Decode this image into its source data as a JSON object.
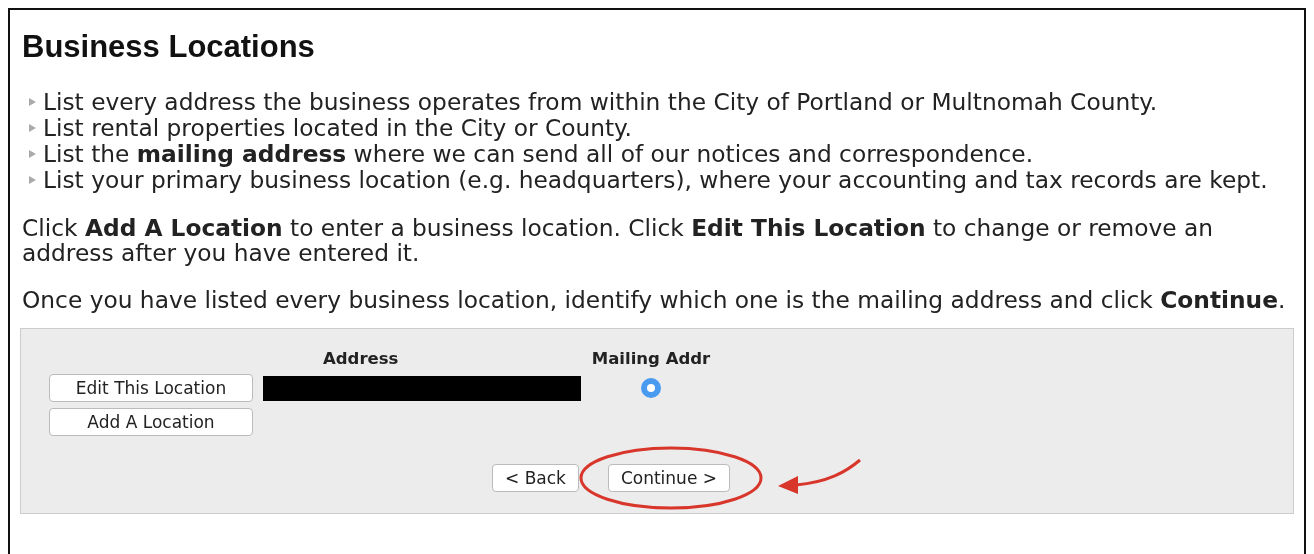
{
  "heading": "Business Locations",
  "bullets": [
    "List every address the business operates from within the City of Portland or Multnomah County.",
    "List rental properties located in the City or County.",
    "List the **mailing address** where we can send all of our notices and correspondence.",
    "List your primary business location (e.g. headquarters), where your accounting and tax records are kept."
  ],
  "paragraphs": [
    "Click **Add A Location** to enter a business location. Click **Edit This Location** to change or remove an address after you have entered it.",
    "Once you have listed every business location, identify which one is the mailing address and click **Continue**."
  ],
  "locations": {
    "columns": [
      "Address",
      "Mailing Addr"
    ],
    "rows": [
      {
        "edit_button": "Edit This Location",
        "address_redacted": true,
        "selected": true
      }
    ],
    "add_button": "Add A Location"
  },
  "nav_buttons": [
    {
      "label": "< Back",
      "highlighted": false
    },
    {
      "label": "Continue >",
      "highlighted": true
    }
  ]
}
